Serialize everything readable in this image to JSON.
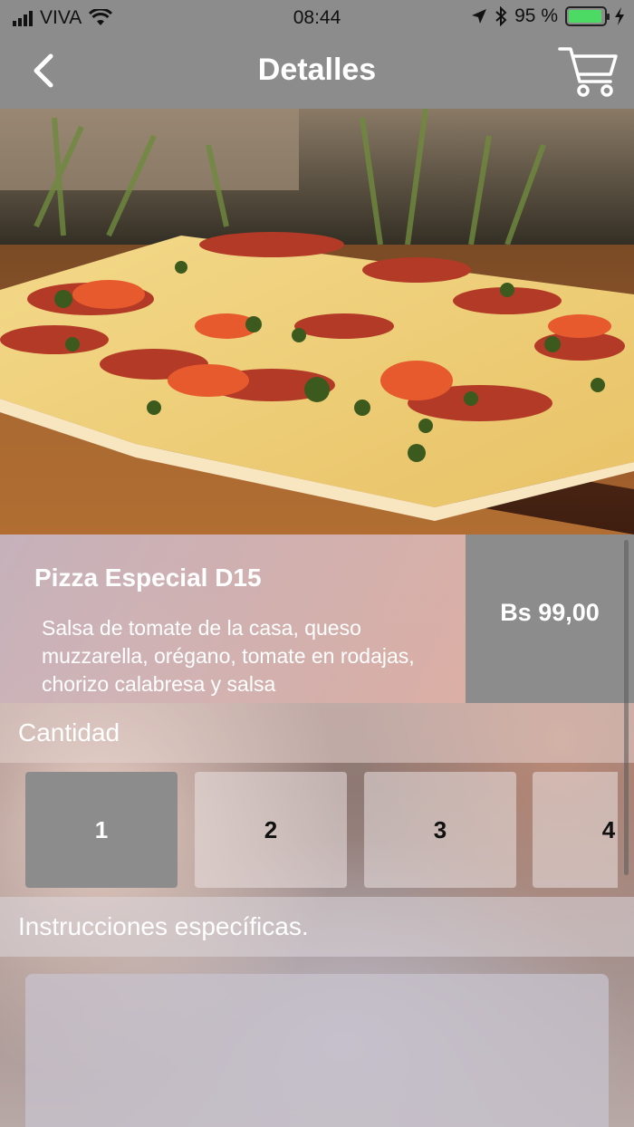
{
  "status_bar": {
    "carrier": "VIVA",
    "time": "08:44",
    "battery_percent": "95 %",
    "battery_level": 0.95
  },
  "nav": {
    "title": "Detalles",
    "back_icon": "chevron-left-icon",
    "cart_icon": "shopping-cart-icon"
  },
  "hero": {
    "image": "pizza-photo"
  },
  "product": {
    "name": "Pizza Especial D15",
    "description": "Salsa de tomate de la casa, queso muzzarella, orégano, tomate en rodajas, chorizo calabresa y salsa",
    "price": "Bs 99,00"
  },
  "quantity": {
    "label": "Cantidad",
    "options": [
      "1",
      "2",
      "3",
      "4"
    ],
    "selected": "1"
  },
  "instructions": {
    "label": "Instrucciones específicas."
  },
  "colors": {
    "bar_gray": "#8c8c8c",
    "battery_green": "#4cd964",
    "text_white": "#ffffff"
  }
}
